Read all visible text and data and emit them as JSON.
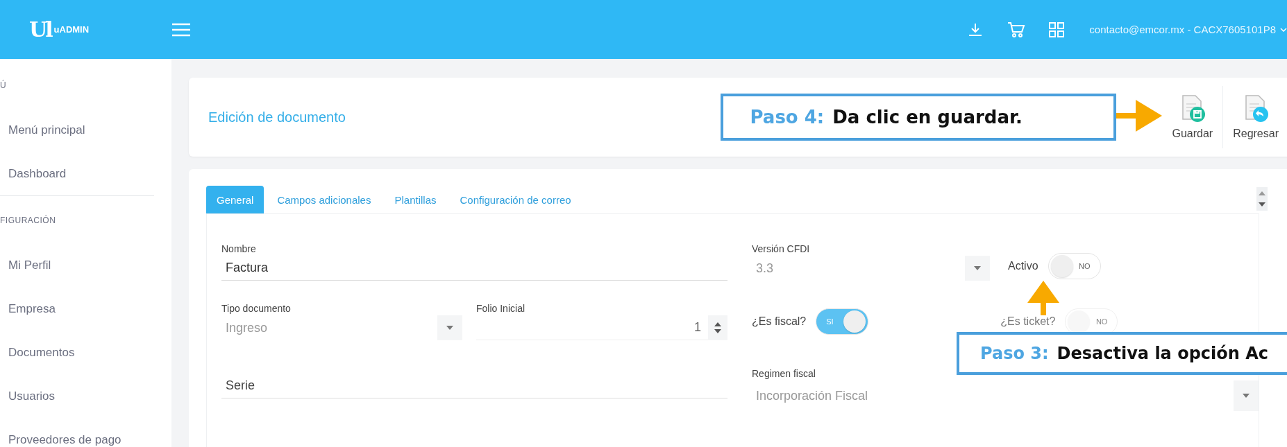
{
  "header": {
    "logo_mark": "Ul",
    "brand": "uADMIN",
    "account": "contacto@emcor.mx - CACX7605101P8"
  },
  "sidebar": {
    "sections": [
      {
        "title": "Ú",
        "items": [
          "Menú principal",
          "Dashboard"
        ]
      },
      {
        "title": "FIGURACIÓN",
        "items": [
          "Mi Perfil",
          "Empresa",
          "Documentos",
          "Usuarios",
          "Proveedores de pago"
        ]
      }
    ]
  },
  "page": {
    "title": "Edición de documento",
    "actions": [
      {
        "kind": "save",
        "label": "Guardar"
      },
      {
        "kind": "back",
        "label": "Regresar"
      }
    ]
  },
  "tabs": [
    {
      "label": "General",
      "selected": true
    },
    {
      "label": "Campos adicionales",
      "selected": false
    },
    {
      "label": "Plantillas",
      "selected": false
    },
    {
      "label": "Configuración de correo",
      "selected": false
    }
  ],
  "form": {
    "nombre": {
      "label": "Nombre",
      "value": "Factura"
    },
    "version_cfdi": {
      "label": "Versión CFDI",
      "value": "3.3",
      "disabled": true
    },
    "activo": {
      "label": "Activo",
      "on": false,
      "text": "NO",
      "disabled": false
    },
    "tipo_documento": {
      "label": "Tipo documento",
      "value": "Ingreso",
      "disabled": true
    },
    "folio_inicial": {
      "label": "Folio Inicial",
      "value": "1"
    },
    "es_fiscal": {
      "label": "¿Es fiscal?",
      "on": true,
      "text": "SI",
      "disabled": false
    },
    "es_ticket": {
      "label": "¿Es ticket?",
      "on": false,
      "text": "NO",
      "disabled": true
    },
    "serie": {
      "placeholder": "Serie"
    },
    "regimen_fiscal": {
      "label": "Regimen fiscal",
      "value": "Incorporación Fiscal",
      "disabled": true
    }
  },
  "callouts": [
    {
      "step": "Paso 4:",
      "text": "Da clic en guardar."
    },
    {
      "step": "Paso 3:",
      "text": "Desactiva la opción Ac"
    }
  ]
}
